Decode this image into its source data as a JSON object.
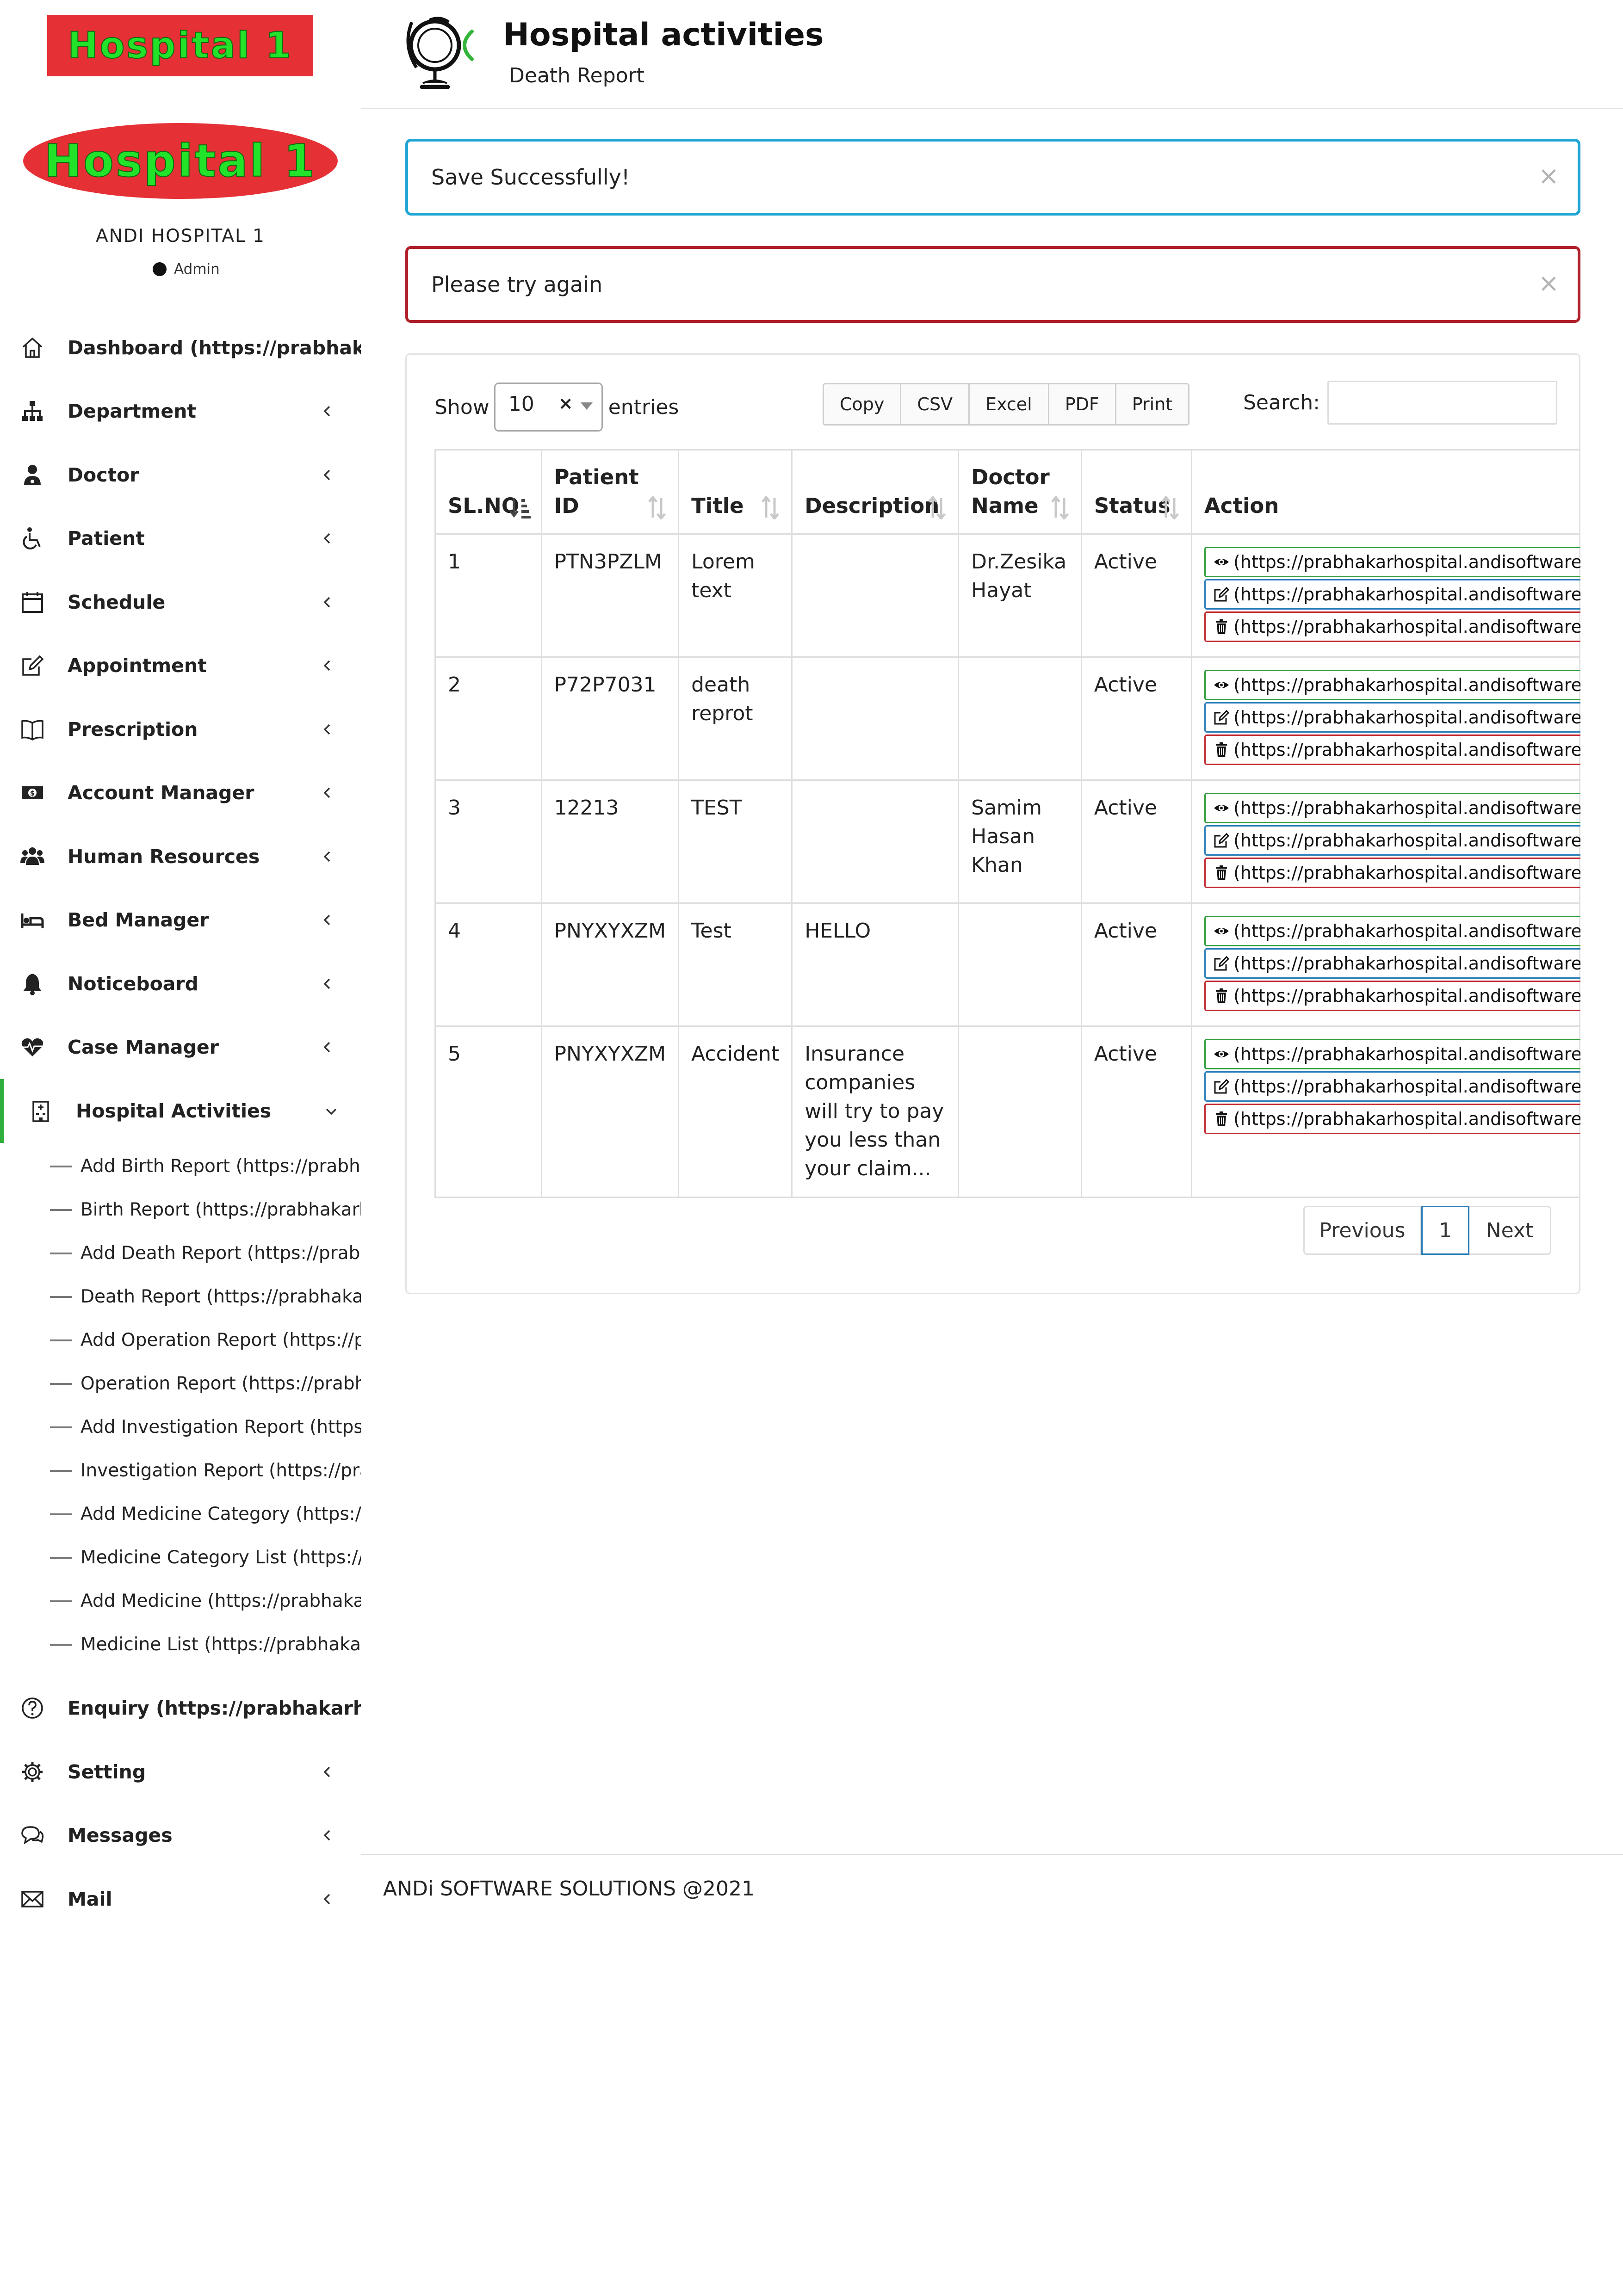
{
  "brand": {
    "logo_top_text": "Hospital 1",
    "logo_oval_text": "Hospital 1",
    "hospital_name": "ANDI HOSPITAL 1",
    "role": "Admin",
    "logo_bg": "#e53035",
    "logo_text_color": "#22e32a"
  },
  "sidebar": {
    "items": [
      {
        "label": "Dashboard (https://prabhakarhospital.andisoftware",
        "icon": "home-icon",
        "has_chevron": false
      },
      {
        "label": "Department",
        "icon": "sitemap-icon",
        "has_chevron": true
      },
      {
        "label": "Doctor",
        "icon": "user-doctor-icon",
        "has_chevron": true
      },
      {
        "label": "Patient",
        "icon": "wheelchair-icon",
        "has_chevron": true
      },
      {
        "label": "Schedule",
        "icon": "calendar-icon",
        "has_chevron": true
      },
      {
        "label": "Appointment",
        "icon": "edit-icon",
        "has_chevron": true
      },
      {
        "label": "Prescription",
        "icon": "book-icon",
        "has_chevron": true
      },
      {
        "label": "Account Manager",
        "icon": "money-icon",
        "has_chevron": true
      },
      {
        "label": "Human Resources",
        "icon": "users-icon",
        "has_chevron": true
      },
      {
        "label": "Bed Manager",
        "icon": "bed-icon",
        "has_chevron": true
      },
      {
        "label": "Noticeboard",
        "icon": "bell-icon",
        "has_chevron": true
      },
      {
        "label": "Case Manager",
        "icon": "heartbeat-icon",
        "has_chevron": true
      },
      {
        "label": "Hospital Activities",
        "icon": "hospital-icon",
        "has_chevron": true
      }
    ],
    "sub_items": [
      "Add Birth Report (https://prabhakarhospital.andisoftware",
      "Birth Report (https://prabhakarhospital.andisoftware",
      "Add Death Report (https://prabhakarhospital.andisoftware",
      "Death Report (https://prabhakarhospital.andisoftware",
      "Add Operation Report (https://prabhakarhospital.andisoftware",
      "Operation Report (https://prabhakarhospital.andisoftware",
      "Add Investigation Report (https://prabhakarhospital.andisoftware",
      "Investigation Report (https://prabhakarhospital.andisoftware",
      "Add Medicine Category (https://prabhakarhospital.andisoftware",
      "Medicine Category List (https://prabhakarhospital.andisoftware",
      "Add Medicine (https://prabhakarhospital.andisoftware",
      "Medicine List (https://prabhakarhospital.andisoftware"
    ],
    "bottom_items": [
      {
        "label": "Enquiry (https://prabhakarhospital.andisoftware",
        "icon": "question-icon",
        "has_chevron": false
      },
      {
        "label": "Setting",
        "icon": "gear-icon",
        "has_chevron": true
      },
      {
        "label": "Messages",
        "icon": "comments-icon",
        "has_chevron": true
      },
      {
        "label": "Mail",
        "icon": "envelope-icon",
        "has_chevron": true
      }
    ]
  },
  "header": {
    "title": "Hospital activities",
    "subtitle": "Death Report"
  },
  "alerts": {
    "success": "Save Successfully!",
    "error": "Please try again",
    "close": "×"
  },
  "table_controls": {
    "show_label": "Show",
    "entries_value": "10",
    "entries_clear": "×",
    "entries_label": "entries",
    "buttons": [
      "Copy",
      "CSV",
      "Excel",
      "PDF",
      "Print"
    ],
    "search_label": "Search:"
  },
  "table": {
    "headers": [
      "SL.NO",
      "Patient ID",
      "Title",
      "Description",
      "Doctor Name",
      "Status",
      "Action"
    ],
    "action_text": "(https://prabhakarhospital.andisoftware",
    "rows": [
      {
        "sl": "1",
        "patient_id": "PTN3PZLM",
        "title": "Lorem text",
        "description": "",
        "doctor": "Dr.Zesika Hayat",
        "status": "Active"
      },
      {
        "sl": "2",
        "patient_id": "P72P7031",
        "title": "death reprot",
        "description": "",
        "doctor": "",
        "status": "Active"
      },
      {
        "sl": "3",
        "patient_id": "12213",
        "title": "TEST",
        "description": "",
        "doctor": "Samim Hasan Khan",
        "status": "Active"
      },
      {
        "sl": "4",
        "patient_id": "PNYXYXZM",
        "title": "Test",
        "description": "HELLO",
        "doctor": "",
        "status": "Active"
      },
      {
        "sl": "5",
        "patient_id": "PNYXYXZM",
        "title": "Accident",
        "description": "Insurance companies will try to pay you less than your claim...",
        "doctor": "",
        "status": "Active"
      }
    ]
  },
  "pagination": {
    "previous": "Previous",
    "current": "1",
    "next": "Next"
  },
  "footer": {
    "text": "ANDi SOFTWARE SOLUTIONS @2021"
  },
  "colors": {
    "success_border": "#20a6d4",
    "error_border": "#b0202b",
    "active_nav": "#2eae3a",
    "view_btn": "#2e9e3a",
    "edit_btn": "#2a7db8",
    "delete_btn": "#c22a32"
  }
}
